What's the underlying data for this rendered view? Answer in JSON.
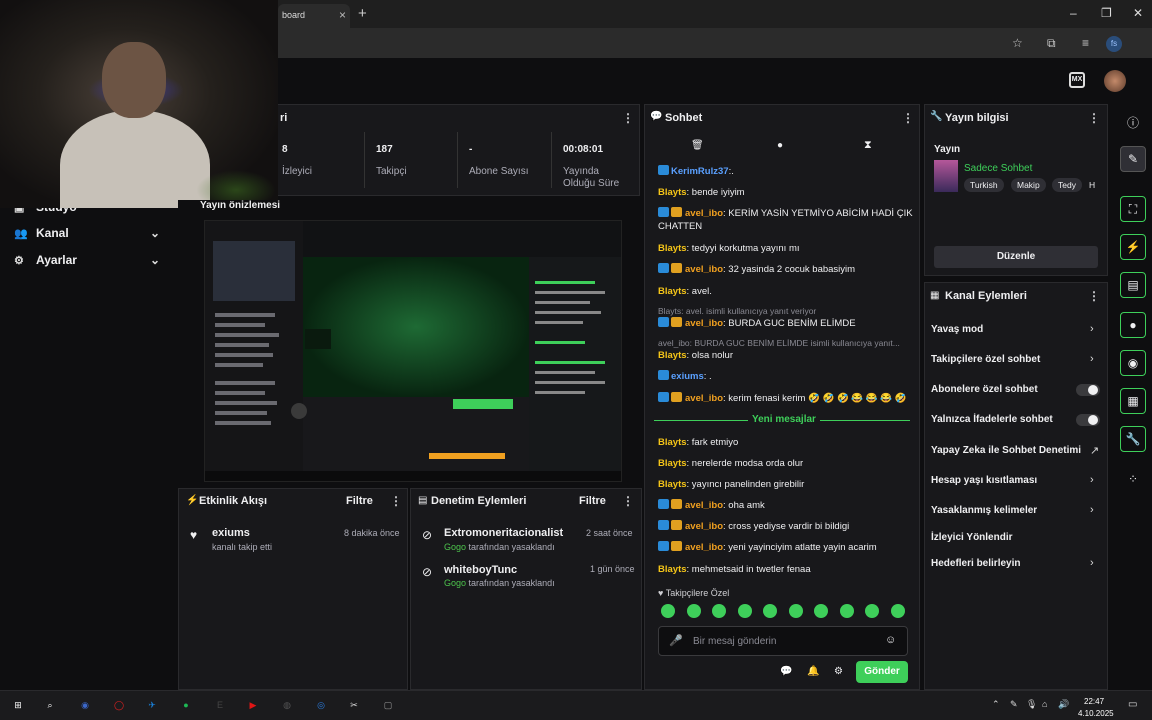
{
  "browser": {
    "tab_title": "board",
    "tab_close": "×",
    "new_tab": "+",
    "minimize": "–",
    "maximize": "❐",
    "close": "✕",
    "profile_initials": "fs"
  },
  "top": {
    "mode_badge": "MX"
  },
  "left_nav": {
    "items": [
      {
        "label": "Stüdyo",
        "icon": "studio-icon"
      },
      {
        "label": "Kanal",
        "icon": "users-icon",
        "chevron": "⌄"
      },
      {
        "label": "Ayarlar",
        "icon": "gear-icon",
        "chevron": "⌄"
      }
    ]
  },
  "stats": {
    "menu_dots": "⋮",
    "title_fragment": "ri",
    "items": [
      {
        "value": "8",
        "label": "İzleyici"
      },
      {
        "value": "187",
        "label": "Takipçi"
      },
      {
        "value": "-",
        "label": "Abone Sayısı"
      },
      {
        "value": "00:08:01",
        "label": "Yayında Olduğu Süre"
      }
    ]
  },
  "preview": {
    "title": "Yayın önizlemesi"
  },
  "activity": {
    "title": "Etkinlik Akışı",
    "filter": "Filtre",
    "items": [
      {
        "user": "exiums",
        "text": "kanalı takip etti",
        "time": "8 dakika önce"
      }
    ]
  },
  "moderation": {
    "title": "Denetim Eylemleri",
    "filter": "Filtre",
    "items": [
      {
        "user": "Extromoneritacionalist",
        "mod": "Gogo",
        "text": "tarafından yasaklandı",
        "time": "2 saat önce"
      },
      {
        "user": "whiteboyTunc",
        "mod": "Gogo",
        "text": "tarafından yasaklandı",
        "time": "1 gün önce"
      }
    ]
  },
  "chat": {
    "title": "Sohbet",
    "new_messages": "Yeni mesajlar",
    "messages": [
      {
        "user": "KerimRulz37",
        "text": ":.",
        "style": "blue",
        "vip": true
      },
      {
        "user": "Blayts",
        "text": ": bende iyiyim",
        "style": "yellow"
      },
      {
        "user": "avel_ibo",
        "text": ": KERİM YASİN YETMİYO ABİCİM HADİ ÇIK CHATTEN",
        "style": "orange",
        "vip": true,
        "crown": true
      },
      {
        "user": "Blayts",
        "text": ": tedyyi korkutma yayını mı",
        "style": "yellow"
      },
      {
        "user": "avel_ibo",
        "text": ": 32 yasinda 2 cocuk babasiyim",
        "style": "orange",
        "vip": true,
        "crown": true
      },
      {
        "user": "Blayts",
        "text": ": avel.",
        "style": "yellow"
      },
      {
        "user": "avel_ibo",
        "text": ": BURDA GUC BENİM ELİMDE",
        "style": "orange",
        "vip": true,
        "crown": true
      },
      {
        "user": "Blayts",
        "text": ": olsa nolur",
        "style": "yellow"
      },
      {
        "user": "exiums",
        "text": ": .",
        "style": "blue",
        "vip": true
      },
      {
        "user": "avel_ibo",
        "text": ": kerim fenasi kerim 🤣 🤣 🤣 😂 😂 😂 🤣",
        "style": "orange",
        "vip": true,
        "crown": true
      },
      {
        "user": "Blayts",
        "text": ": fark etmiyo",
        "style": "yellow"
      },
      {
        "user": "Blayts",
        "text": ": nerelerde modsa orda olur",
        "style": "yellow"
      },
      {
        "user": "Blayts",
        "text": ": yayıncı panelinden girebilir",
        "style": "yellow"
      },
      {
        "user": "avel_ibo",
        "text": ": oha amk",
        "style": "orange",
        "vip": true,
        "crown": true
      },
      {
        "user": "avel_ibo",
        "text": ": cross yediyse vardir bi bildigi",
        "style": "orange",
        "vip": true,
        "crown": true
      },
      {
        "user": "avel_ibo",
        "text": ": yeni yayinciyim atlatte yayin acarim",
        "style": "orange",
        "vip": true,
        "crown": true
      },
      {
        "user": "Blayts",
        "text": ": mehmetsaid in twetler fenaa",
        "style": "yellow"
      }
    ],
    "system": [
      "Blayts: avel. isimli kullanıcıya yanıt veriyor",
      "avel_ibo: BURDA GUC BENİM ELİMDE isimli kullanıcıya yanıt..."
    ],
    "followers_only": "Takipçilere Özel",
    "input_placeholder": "Bir mesaj gönderin",
    "send": "Gönder"
  },
  "stream_info": {
    "title": "Yayın bilgisi",
    "section": "Yayın",
    "category": "Sadece Sohbet",
    "tags": [
      "Turkish",
      "Makip",
      "Tedy",
      "H"
    ],
    "edit": "Düzenle"
  },
  "channel_actions": {
    "title": "Kanal Eylemleri",
    "items": [
      {
        "label": "Yavaş mod",
        "control": "chevron"
      },
      {
        "label": "Takipçilere özel sohbet",
        "control": "chevron"
      },
      {
        "label": "Abonelere özel sohbet",
        "control": "toggle"
      },
      {
        "label": "Yalnızca İfadelerle sohbet",
        "control": "toggle"
      },
      {
        "label": "Yapay Zeka ile Sohbet Denetimi",
        "control": "external"
      },
      {
        "label": "Hesap yaşı kısıtlaması",
        "control": "chevron"
      },
      {
        "label": "Yasaklanmış kelimeler",
        "control": "chevron"
      },
      {
        "label": "İzleyici Yönlendir",
        "control": "none"
      },
      {
        "label": "Hedefleri belirleyin",
        "control": "chevron"
      }
    ]
  },
  "taskbar": {
    "time": "22:47",
    "date": "4.10.2025",
    "icons": [
      "windows-icon",
      "search-icon",
      "opera-gx-icon",
      "opera-icon",
      "steam-icon",
      "spotify-icon",
      "epic-icon",
      "youtube-icon",
      "obs-icon",
      "chrome-icon",
      "capcut-icon",
      "app-icon"
    ]
  },
  "colors": {
    "accent_green": "#3ecf5a",
    "bg": "#0e0e10",
    "panel": "#18181b"
  }
}
